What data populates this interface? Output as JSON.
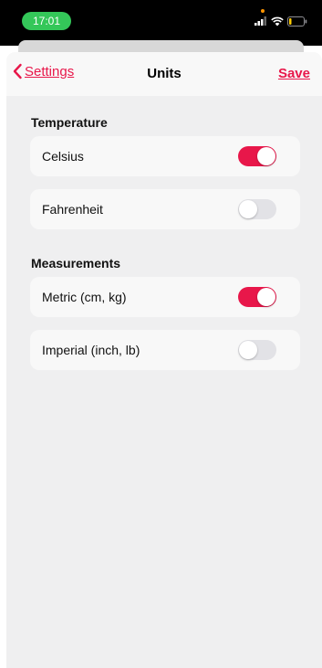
{
  "status_bar": {
    "time": "17:01",
    "icons": [
      "signal-icon",
      "wifi-icon",
      "battery-icon"
    ]
  },
  "nav": {
    "back_label": "Settings",
    "title": "Units",
    "save_label": "Save"
  },
  "sections": [
    {
      "title": "Temperature",
      "options": [
        {
          "label": "Celsius",
          "enabled": true
        },
        {
          "label": "Fahrenheit",
          "enabled": false
        }
      ]
    },
    {
      "title": "Measurements",
      "options": [
        {
          "label": "Metric (cm, kg)",
          "enabled": true
        },
        {
          "label": "Imperial (inch, lb)",
          "enabled": false
        }
      ]
    }
  ],
  "colors": {
    "accent": "#e8174a",
    "toggle_off": "#e2e2e6",
    "background": "#efeff0",
    "time_pill": "#34c759"
  }
}
